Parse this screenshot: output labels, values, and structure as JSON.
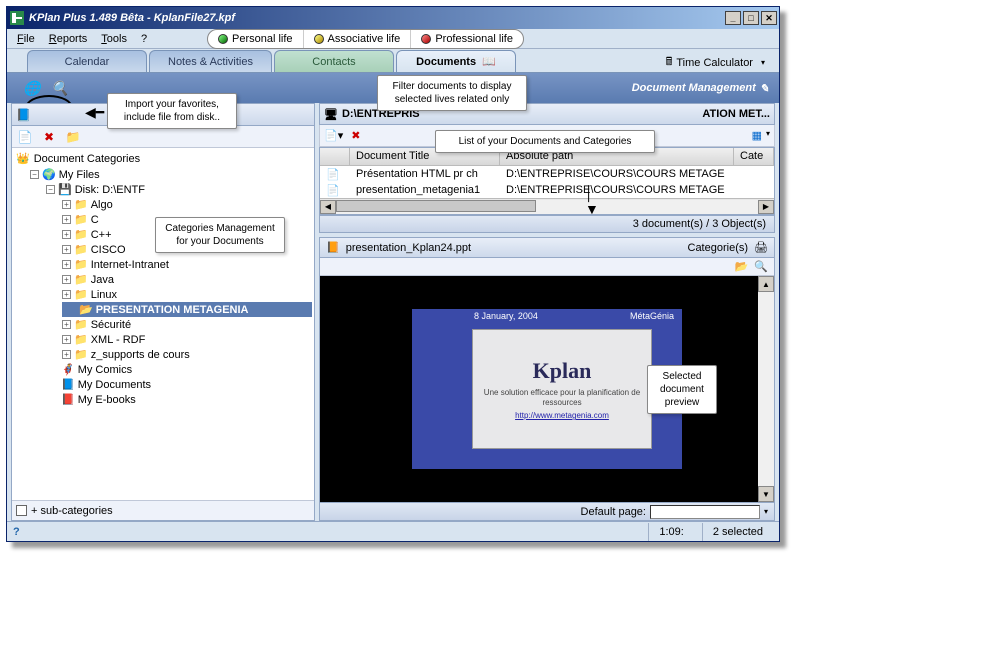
{
  "window": {
    "title": "KPlan Plus 1.489 Bêta - KplanFile27.kpf"
  },
  "menu": {
    "file": "File",
    "reports": "Reports",
    "tools": "Tools",
    "help": "?"
  },
  "lives": {
    "personal": "Personal life",
    "associative": "Associative life",
    "professional": "Professional life"
  },
  "tabs": {
    "calendar": "Calendar",
    "notes": "Notes & Activities",
    "contacts": "Contacts",
    "documents": "Documents",
    "timecalc": "Time Calculator"
  },
  "header": {
    "title": "Document Management"
  },
  "left": {
    "title": "Document Categories",
    "root": "Document Categories",
    "myfiles": "My Files",
    "disk": "Disk: D:\\ENTF",
    "items": [
      "Algo",
      "C",
      "C++",
      "CISCO",
      "Internet-Intranet",
      "Java",
      "Linux"
    ],
    "selected": "PRESENTATION METAGENIA",
    "after": [
      "Sécurité",
      "XML - RDF",
      "z_supports de cours"
    ],
    "mycomics": "My Comics",
    "mydocs": "My Documents",
    "myebooks": "My E-books",
    "subcat": "+ sub-categories"
  },
  "path": {
    "prefix": "D:\\ENTREPRIS",
    "suffix": "ATION MET..."
  },
  "doclist": {
    "col_title": "Document Title",
    "col_path": "Absolute path",
    "col_cat": "Cate",
    "rows": [
      {
        "title": "Présentation HTML pr ch",
        "path": "D:\\ENTREPRISE\\COURS\\COURS METAGE"
      },
      {
        "title": "presentation_metagenia1",
        "path": "D:\\ENTREPRISE\\COURS\\COURS METAGE"
      }
    ],
    "status": "3 document(s) / 3 Object(s)"
  },
  "preview": {
    "filename": "presentation_Kplan24.ppt",
    "cat_label": "Categorie(s)",
    "slide": {
      "date": "8 January, 2004",
      "brand": "MétaGénia",
      "title": "Kplan",
      "sub": "Une solution efficace pour la planification de ressources",
      "link": "http://www.metagenia.com"
    },
    "default_label": "Default page:"
  },
  "status": {
    "time": "1:09:",
    "sel": "2 selected"
  },
  "callouts": {
    "import": "Import your favorites, include file from disk..",
    "filter": "Filter documents to display selected lives related only",
    "list": "List of your Documents and Categories",
    "categories": "Categories Management for your Documents",
    "preview": "Selected document preview"
  }
}
